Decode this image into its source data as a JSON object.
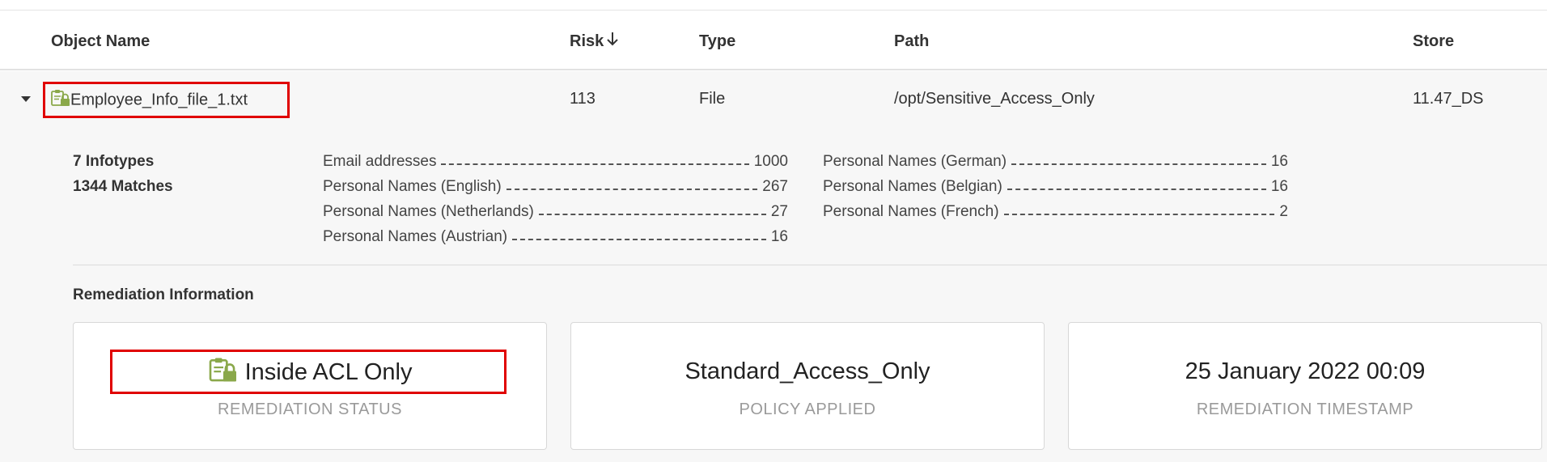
{
  "table": {
    "headers": {
      "object_name": "Object Name",
      "risk": "Risk",
      "risk_sort_icon": "arrow-down-icon",
      "type": "Type",
      "path": "Path",
      "store": "Store"
    },
    "row": {
      "expand_icon": "caret-down-icon",
      "file_icon": "clipboard-lock-icon",
      "object_name": "Employee_Info_file_1.txt",
      "risk": "113",
      "type": "File",
      "path": "/opt/Sensitive_Access_Only",
      "store": "11.47_DS"
    }
  },
  "details": {
    "infotypes": "7 Infotypes",
    "matches": "1344 Matches",
    "match_list_left": [
      {
        "label": "Email addresses",
        "count": "1000"
      },
      {
        "label": "Personal Names (English)",
        "count": "267"
      },
      {
        "label": "Personal Names (Netherlands)",
        "count": "27"
      },
      {
        "label": "Personal Names (Austrian)",
        "count": "16"
      }
    ],
    "match_list_right": [
      {
        "label": "Personal Names (German)",
        "count": "16"
      },
      {
        "label": "Personal Names (Belgian)",
        "count": "16"
      },
      {
        "label": "Personal Names (French)",
        "count": "2"
      }
    ]
  },
  "remediation": {
    "title": "Remediation Information",
    "status": {
      "value": "Inside ACL Only",
      "label": "REMEDIATION STATUS",
      "icon": "clipboard-lock-icon"
    },
    "policy": {
      "value": "Standard_Access_Only",
      "label": "POLICY APPLIED"
    },
    "timestamp": {
      "value": "25 January 2022 00:09",
      "label": "REMEDIATION TIMESTAMP"
    }
  },
  "colors": {
    "highlight_border": "#e00000",
    "icon_green": "#8aa84a",
    "row_background": "#f7f7f7"
  }
}
